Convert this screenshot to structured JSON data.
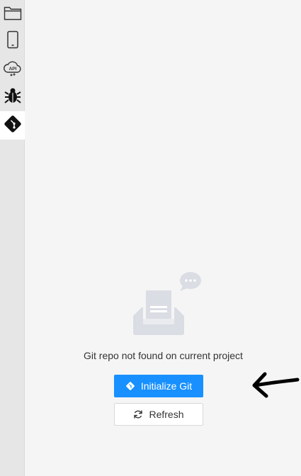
{
  "activity_bar": {
    "items": [
      {
        "icon": "folder-icon"
      },
      {
        "icon": "mobile-phone-icon"
      },
      {
        "icon": "api-cloud-icon"
      },
      {
        "icon": "bug-icon"
      },
      {
        "icon": "git-icon",
        "active": true
      }
    ]
  },
  "git_panel": {
    "empty_icon": "empty-inbox-icon",
    "message": "Git repo not found on current project",
    "init_button_label": "Initialize Git",
    "refresh_button_label": "Refresh"
  },
  "colors": {
    "primary": "#1890ff",
    "background": "#f5f5f5",
    "activity_bar": "#e6e6e6"
  }
}
